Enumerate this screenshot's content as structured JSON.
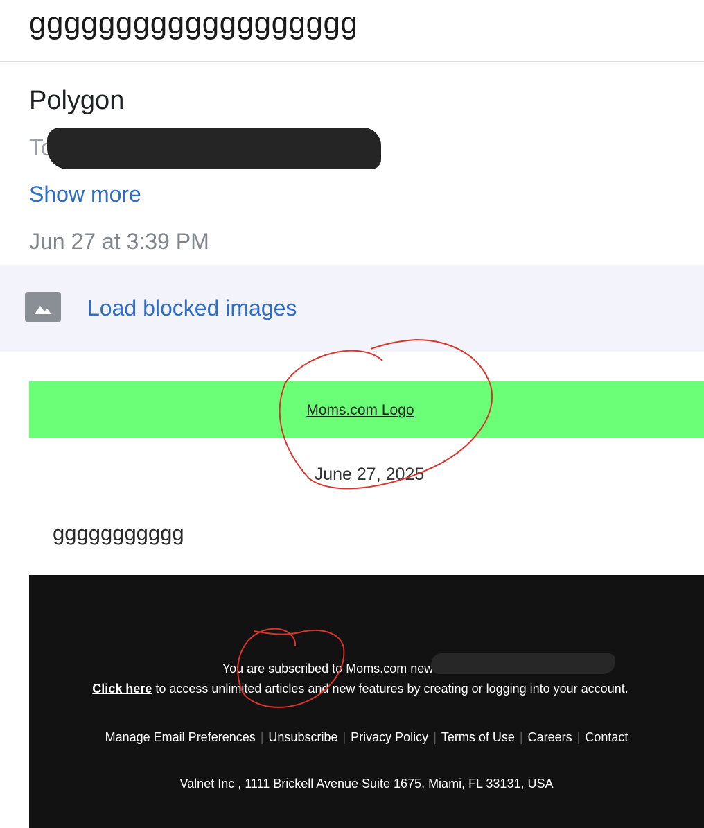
{
  "header": {
    "subject": "ggggggggggggggggggg"
  },
  "message": {
    "sender": "Polygon",
    "to_prefix": "To",
    "show_more": "Show more",
    "timestamp": "Jun 27 at 3:39 PM"
  },
  "blocked_images": {
    "icon": "image-placeholder-icon",
    "label": "Load blocked images"
  },
  "email": {
    "logo_alt": "Moms.com Logo",
    "logo_band_color": "#6bff77",
    "date": "June 27, 2025",
    "body": "ggggggggggg"
  },
  "footer": {
    "subscribed_text": "You are subscribed to Moms.com newsletters as",
    "click_here": "Click here",
    "access_text": "to access unlimited articles and new features by creating or logging into your account.",
    "links": [
      "Manage Email Preferences",
      "Unsubscribe",
      "Privacy Policy",
      "Terms of Use",
      "Careers",
      "Contact"
    ],
    "address": "Valnet Inc , 1111 Brickell Avenue Suite 1675, Miami, FL 33131, USA"
  },
  "colors": {
    "link_blue": "#2f6dc7",
    "footer_bg": "#121212",
    "annotation_red": "#d9342b"
  }
}
